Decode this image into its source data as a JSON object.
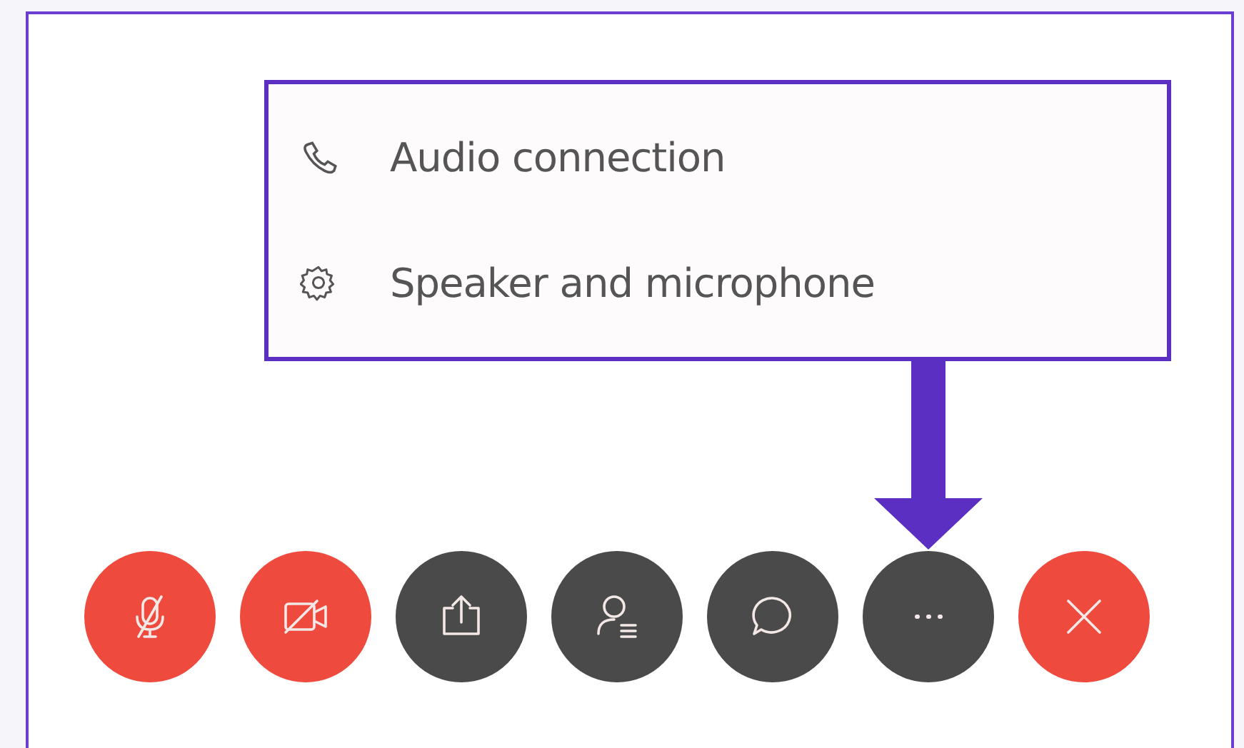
{
  "menu": {
    "items": [
      {
        "kind": "phone",
        "label": "Audio connection"
      },
      {
        "kind": "gear",
        "label": "Speaker and microphone"
      }
    ]
  },
  "toolbar": {
    "buttons": [
      {
        "kind": "mic-off",
        "color": "#ee4b3e"
      },
      {
        "kind": "video-off",
        "color": "#ee4b3e"
      },
      {
        "kind": "share",
        "color": "#4a4a4a"
      },
      {
        "kind": "participants",
        "color": "#4a4a4a"
      },
      {
        "kind": "chat",
        "color": "#4a4a4a"
      },
      {
        "kind": "more",
        "color": "#4a4a4a"
      },
      {
        "kind": "leave",
        "color": "#ee4b3e"
      }
    ]
  }
}
